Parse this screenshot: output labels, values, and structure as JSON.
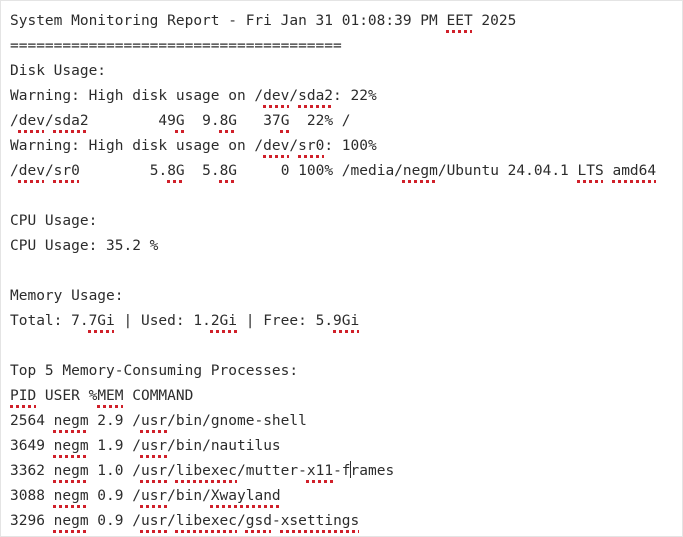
{
  "document": {
    "lines": [
      [
        "System Monitoring Report - Fri Jan 31 01:08:39 PM ",
        {
          "t": "EET",
          "s": 1
        },
        " 2025"
      ],
      [
        "======================================"
      ],
      [
        "Disk Usage:"
      ],
      [
        "Warning: High disk usage on /",
        {
          "t": "dev",
          "s": 1
        },
        "/",
        {
          "t": "sda2",
          "s": 1
        },
        ": 22%"
      ],
      [
        "/",
        {
          "t": "dev",
          "s": 1
        },
        "/",
        {
          "t": "sda2",
          "s": 1
        },
        "        49",
        {
          "t": "G",
          "s": 1
        },
        "  9.",
        {
          "t": "8G",
          "s": 1
        },
        "   37",
        {
          "t": "G",
          "s": 1
        },
        "  22% /"
      ],
      [
        "Warning: High disk usage on /",
        {
          "t": "dev",
          "s": 1
        },
        "/",
        {
          "t": "sr0",
          "s": 1
        },
        ": 100%"
      ],
      [
        "/",
        {
          "t": "dev",
          "s": 1
        },
        "/",
        {
          "t": "sr0",
          "s": 1
        },
        "        5.",
        {
          "t": "8G",
          "s": 1
        },
        "  5.",
        {
          "t": "8G",
          "s": 1
        },
        "     0 100% /media/",
        {
          "t": "negm",
          "s": 1
        },
        "/Ubuntu 24.04.1 ",
        {
          "t": "LTS",
          "s": 1
        },
        " ",
        {
          "t": "amd64",
          "s": 1
        }
      ],
      [
        ""
      ],
      [
        "CPU Usage:"
      ],
      [
        "CPU Usage: 35.2 %"
      ],
      [
        ""
      ],
      [
        "Memory Usage:"
      ],
      [
        "Total: 7.",
        {
          "t": "7Gi",
          "s": 1
        },
        " | Used: 1.",
        {
          "t": "2Gi",
          "s": 1
        },
        " | Free: 5.",
        {
          "t": "9Gi",
          "s": 1
        }
      ],
      [
        ""
      ],
      [
        "Top 5 Memory-Consuming Processes:"
      ],
      [
        {
          "t": "PID",
          "s": 1
        },
        " USER %",
        {
          "t": "MEM",
          "s": 1
        },
        " COMMAND"
      ],
      [
        "2564 ",
        {
          "t": "negm",
          "s": 1
        },
        " 2.9 /",
        {
          "t": "usr",
          "s": 1
        },
        "/bin/gnome-shell"
      ],
      [
        "3649 ",
        {
          "t": "negm",
          "s": 1
        },
        " 1.9 /",
        {
          "t": "usr",
          "s": 1
        },
        "/bin/nautilus"
      ],
      [
        "3362 ",
        {
          "t": "negm",
          "s": 1
        },
        " 1.0 /",
        {
          "t": "usr",
          "s": 1
        },
        "/",
        {
          "t": "libexec",
          "s": 1
        },
        "/mutter-",
        {
          "t": "x11",
          "s": 1
        },
        "-f",
        {
          "caret": 1
        },
        "rames"
      ],
      [
        "3088 ",
        {
          "t": "negm",
          "s": 1
        },
        " 0.9 /",
        {
          "t": "usr",
          "s": 1
        },
        "/bin/",
        {
          "t": "Xwayland",
          "s": 1
        }
      ],
      [
        "3296 ",
        {
          "t": "negm",
          "s": 1
        },
        " 0.9 /",
        {
          "t": "usr",
          "s": 1
        },
        "/",
        {
          "t": "libexec",
          "s": 1
        },
        "/",
        {
          "t": "gsd",
          "s": 1
        },
        "-",
        {
          "t": "xsettings",
          "s": 1
        }
      ]
    ]
  }
}
